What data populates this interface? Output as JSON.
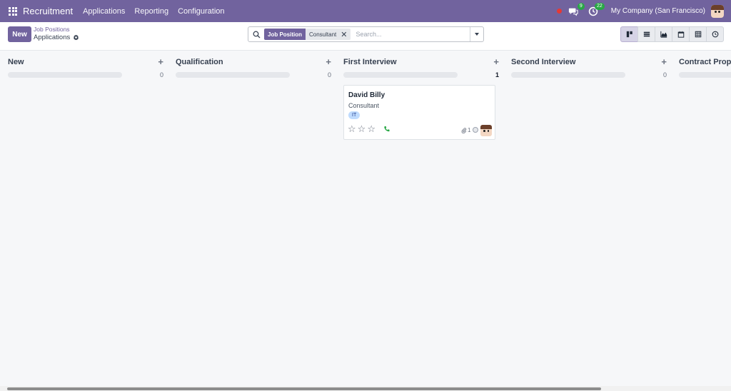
{
  "navbar": {
    "app_name": "Recruitment",
    "menu": [
      {
        "label": "Applications"
      },
      {
        "label": "Reporting"
      },
      {
        "label": "Configuration"
      }
    ],
    "messages_count": "9",
    "activities_count": "22",
    "company": "My Company (San Francisco)"
  },
  "control": {
    "new_label": "New",
    "breadcrumb_parent": "Job Positions",
    "breadcrumb_current": "Applications",
    "search": {
      "facet_label": "Job Position",
      "facet_value": "Consultant",
      "placeholder": "Search..."
    },
    "views": [
      "kanban-view",
      "list-view",
      "graph-view",
      "calendar-view",
      "pivot-view",
      "activity-view"
    ],
    "active_view": "kanban-view"
  },
  "kanban": {
    "columns": [
      {
        "title": "New",
        "count": "0"
      },
      {
        "title": "Qualification",
        "count": "0"
      },
      {
        "title": "First Interview",
        "count": "1"
      },
      {
        "title": "Second Interview",
        "count": "0"
      },
      {
        "title": "Contract Proposal",
        "count": ""
      }
    ],
    "card": {
      "name": "David Billy",
      "job": "Consultant",
      "tag": "IT",
      "rating": 0,
      "rating_max": 3,
      "attachments": "1"
    }
  },
  "colors": {
    "brand": "#71639e",
    "badge": "#28a745",
    "rec_dot": "#e53935",
    "tag_bg": "#bfdbfe",
    "phone": "#28a745"
  }
}
